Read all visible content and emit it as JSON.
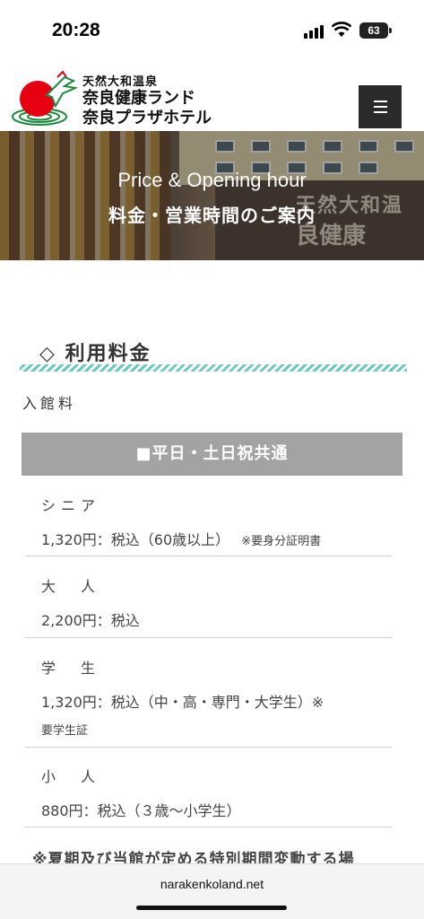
{
  "status_bar": {
    "time": "20:28",
    "battery": "63"
  },
  "header": {
    "logo_line1": "天然大和温泉",
    "logo_line2": "奈良健康ランド",
    "logo_line3": "奈良プラザホテル",
    "menu_icon": "hamburger-menu-icon",
    "logo_colors": {
      "red": "#e60012",
      "green": "#1a8a3a"
    }
  },
  "hero": {
    "title_en": "Price & Opening hour",
    "title_jp": "料金・営業時間のご案内",
    "sign_line1": "天然大和温",
    "sign_line2": "良健康"
  },
  "section": {
    "title": "◇ 利用料金",
    "subheading": "入館料",
    "band": "■平日・土日祝共通"
  },
  "prices": [
    {
      "label": "シニア",
      "price": "1,320円：税込（60歳以上）",
      "note": "※要身分証明書"
    },
    {
      "label": "大　人",
      "price": "2,200円：税込",
      "note": ""
    },
    {
      "label": "学　生",
      "price": "1,320円：税込（中・高・専門・大学生）※",
      "note": "要学生証"
    },
    {
      "label": "小　人",
      "price": "880円：税込（３歳～小学生）",
      "note": ""
    }
  ],
  "warning": "※夏期及び当館が定める特別期間変動する場",
  "browser": {
    "url": "narakenkoland.net"
  },
  "colors": {
    "accent_stripe": "#6cc9c0",
    "band": "#a3a3a3",
    "menu_bg": "#2b2b2b"
  }
}
